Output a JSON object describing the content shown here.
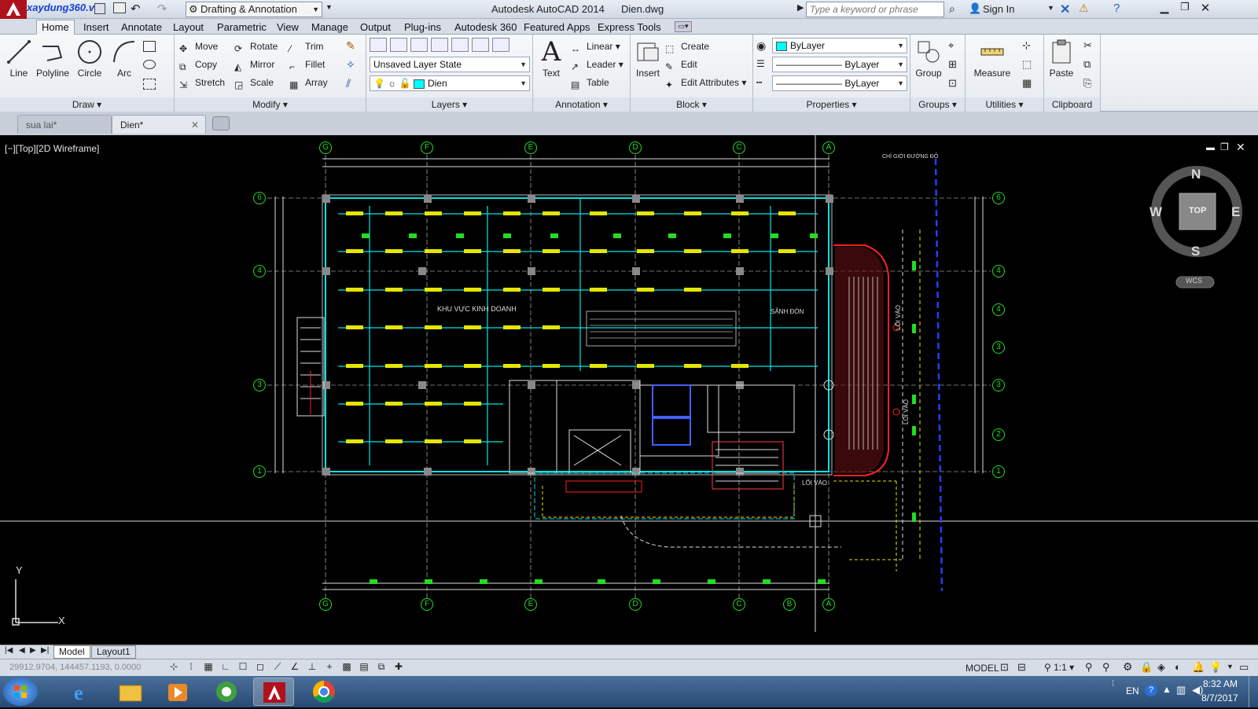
{
  "titlebar": {
    "logo_text": "xaydung360.vn",
    "workspace": "Drafting & Annotation",
    "app_title": "Autodesk AutoCAD 2014",
    "file_title": "Dien.dwg",
    "search_placeholder": "Type a keyword or phrase",
    "sign_in": "Sign In"
  },
  "ribbon_tabs": [
    "Home",
    "Insert",
    "Annotate",
    "Layout",
    "Parametric",
    "View",
    "Manage",
    "Output",
    "Plug-ins",
    "Autodesk 360",
    "Featured Apps",
    "Express Tools"
  ],
  "draw": {
    "line": "Line",
    "polyline": "Polyline",
    "circle": "Circle",
    "arc": "Arc",
    "title": "Draw"
  },
  "modify": {
    "move": "Move",
    "rotate": "Rotate",
    "trim": "Trim",
    "copy": "Copy",
    "mirror": "Mirror",
    "fillet": "Fillet",
    "stretch": "Stretch",
    "scale": "Scale",
    "array": "Array",
    "title": "Modify"
  },
  "layers": {
    "layer_state": "Unsaved Layer State",
    "current_layer": "Dien",
    "title": "Layers"
  },
  "annotation": {
    "text": "Text",
    "linear": "Linear",
    "leader": "Leader",
    "table": "Table",
    "title": "Annotation"
  },
  "block": {
    "insert": "Insert",
    "create": "Create",
    "edit": "Edit",
    "edit_attributes": "Edit Attributes",
    "title": "Block"
  },
  "properties": {
    "color": "ByLayer",
    "linetype": "ByLayer",
    "lineweight": "ByLayer",
    "title": "Properties"
  },
  "groups": {
    "group": "Group",
    "title": "Groups"
  },
  "utilities": {
    "measure": "Measure",
    "title": "Utilities"
  },
  "clipboard": {
    "paste": "Paste",
    "title": "Clipboard"
  },
  "doc_tabs": [
    {
      "label": "sua lai*"
    },
    {
      "label": "Dien*"
    }
  ],
  "viewport": {
    "label": "[−][Top][2D Wireframe]",
    "compass": {
      "n": "N",
      "s": "S",
      "e": "E",
      "w": "W",
      "top": "TOP",
      "wcs": "WCS"
    },
    "drawing_text": {
      "area_business": "KHU VỰC KINH DOANH",
      "lobby": "SẢNH ĐÓN",
      "entrance1": "LỐI VÀO",
      "entrance2": "LỐI VÀO",
      "entrance3": "LỐI VÀO",
      "boundary": "CHỈ GIỚI ĐƯỜNG ĐỎ"
    },
    "grid_top": [
      "G",
      "F",
      "E",
      "D",
      "C",
      "A"
    ],
    "grid_bottom": [
      "G",
      "F",
      "E",
      "D",
      "C",
      "B",
      "A"
    ],
    "grid_left": [
      "6",
      "4",
      "3",
      "1"
    ],
    "grid_right": [
      "6",
      "4",
      "4",
      "3",
      "3",
      "2",
      "1"
    ],
    "ucs": {
      "x": "X",
      "y": "Y"
    }
  },
  "layout_tabs": [
    "Model",
    "Layout1"
  ],
  "status": {
    "coords": "29912.9704, 144457.1193, 0.0000",
    "space": "MODEL",
    "scale": "1:1"
  },
  "taskbar": {
    "lang": "EN",
    "time": "8:32 AM",
    "date": "8/7/2017"
  }
}
